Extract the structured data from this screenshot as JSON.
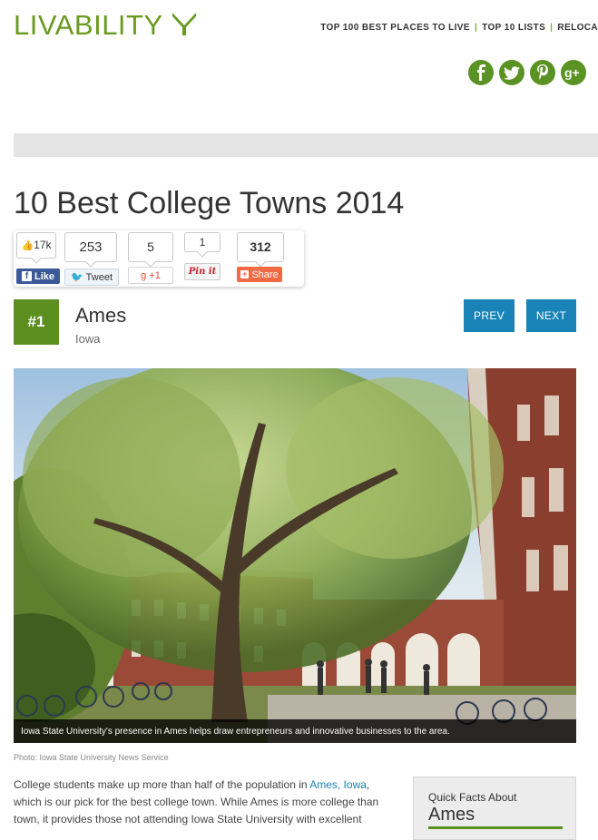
{
  "site": {
    "logo_text": "LIVABILITY"
  },
  "topnav": {
    "items": [
      "TOP 100 BEST PLACES TO LIVE",
      "TOP 10 LISTS",
      "RELOCA"
    ]
  },
  "social_icons": [
    "facebook-icon",
    "twitter-icon",
    "pinterest-icon",
    "google-plus-icon"
  ],
  "page": {
    "title": "10 Best College Towns 2014"
  },
  "share": {
    "like_count": "17k",
    "like_label": "Like",
    "tweet_count": "253",
    "tweet_label": "Tweet",
    "gplus_count": "5",
    "gplus_label": "+1",
    "pin_count": "1",
    "pin_label": "Pin it",
    "share_count": "312",
    "share_label": "Share"
  },
  "entry": {
    "rank": "#1",
    "city": "Ames",
    "state": "Iowa",
    "prev_label": "PREV",
    "next_label": "NEXT"
  },
  "photo": {
    "caption": "Iowa State University's presence in Ames helps draw entrepreneurs and innovative businesses to the area.",
    "credit": "Photo: Iowa State University News Service"
  },
  "article": {
    "lead": "College students make up more than half of the population in ",
    "link": "Ames, Iowa",
    "rest": ", which is our pick for the best college town. While Ames is more college than town, it provides those not attending Iowa State University with excellent"
  },
  "quick_facts": {
    "heading": "Quick Facts About",
    "city": "Ames"
  },
  "colors": {
    "brand_green": "#5b8f1f",
    "link_blue": "#1983b8"
  }
}
